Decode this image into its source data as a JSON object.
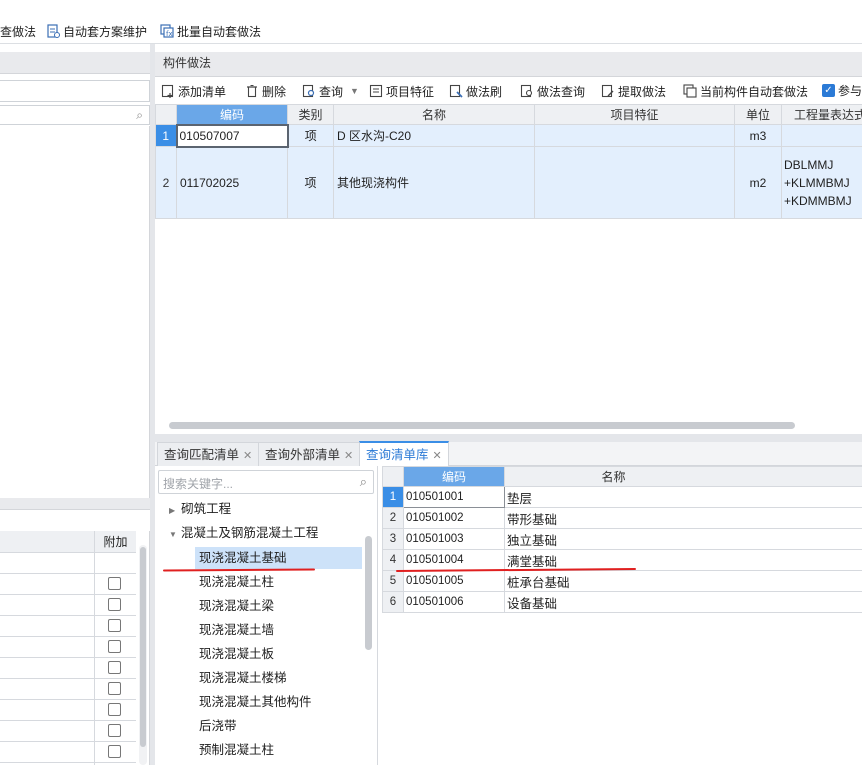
{
  "top_toolbar": {
    "items": [
      {
        "label": "查做法",
        "icon": "search-doc-icon"
      },
      {
        "label": "自动套方案维护",
        "icon": "auto-scheme-icon"
      },
      {
        "label": "批量自动套做法",
        "icon": "batch-auto-icon"
      }
    ]
  },
  "component_panel": {
    "title": "构件做法",
    "toolbar": {
      "add_list": "添加清单",
      "delete": "删除",
      "query": "查询",
      "item_feature": "项目特征",
      "method_brush": "做法刷",
      "method_query": "做法查询",
      "extract_method": "提取做法",
      "current_auto": "当前构件自动套做法",
      "participate": "参与"
    },
    "columns": [
      "编码",
      "类别",
      "名称",
      "项目特征",
      "单位",
      "工程量表达式"
    ],
    "rows": [
      {
        "num": "1",
        "code": "010507007",
        "type": "项",
        "name": "D 区水沟-C20",
        "feature": "",
        "unit": "m3",
        "expr": ""
      },
      {
        "num": "2",
        "code": "011702025",
        "type": "项",
        "name": "其他现浇构件",
        "feature": "",
        "unit": "m2",
        "expr_lines": [
          "DBLMMJ",
          "+KLMMBMJ",
          "+KDMMBMJ"
        ]
      }
    ]
  },
  "left_bottom": {
    "column_extra": "附加"
  },
  "bottom_tabs": [
    {
      "label": "查询匹配清单",
      "active": false
    },
    {
      "label": "查询外部清单",
      "active": false
    },
    {
      "label": "查询清单库",
      "active": true
    }
  ],
  "tree": {
    "search_placeholder": "搜索关键字...",
    "items": [
      {
        "label": "砌筑工程",
        "level": 0,
        "expanded": false,
        "selected": false
      },
      {
        "label": "混凝土及钢筋混凝土工程",
        "level": 0,
        "expanded": true,
        "selected": false
      },
      {
        "label": "现浇混凝土基础",
        "level": 1,
        "selected": true
      },
      {
        "label": "现浇混凝土柱",
        "level": 1,
        "selected": false
      },
      {
        "label": "现浇混凝土梁",
        "level": 1,
        "selected": false
      },
      {
        "label": "现浇混凝土墙",
        "level": 1,
        "selected": false
      },
      {
        "label": "现浇混凝土板",
        "level": 1,
        "selected": false
      },
      {
        "label": "现浇混凝土楼梯",
        "level": 1,
        "selected": false
      },
      {
        "label": "现浇混凝土其他构件",
        "level": 1,
        "selected": false
      },
      {
        "label": "后浇带",
        "level": 1,
        "selected": false
      },
      {
        "label": "预制混凝土柱",
        "level": 1,
        "selected": false
      }
    ]
  },
  "library_grid": {
    "columns": [
      "编码",
      "名称"
    ],
    "rows": [
      {
        "num": "1",
        "code": "010501001",
        "name": "垫层"
      },
      {
        "num": "2",
        "code": "010501002",
        "name": "带形基础"
      },
      {
        "num": "3",
        "code": "010501003",
        "name": "独立基础"
      },
      {
        "num": "4",
        "code": "010501004",
        "name": "满堂基础"
      },
      {
        "num": "5",
        "code": "010501005",
        "name": "桩承台基础"
      },
      {
        "num": "6",
        "code": "010501006",
        "name": "设备基础"
      }
    ]
  },
  "colors": {
    "accent": "#3a8ee6",
    "header_sel": "#6aa7e8",
    "row_highlight": "#e3effd",
    "annotation_red": "#e02020"
  }
}
